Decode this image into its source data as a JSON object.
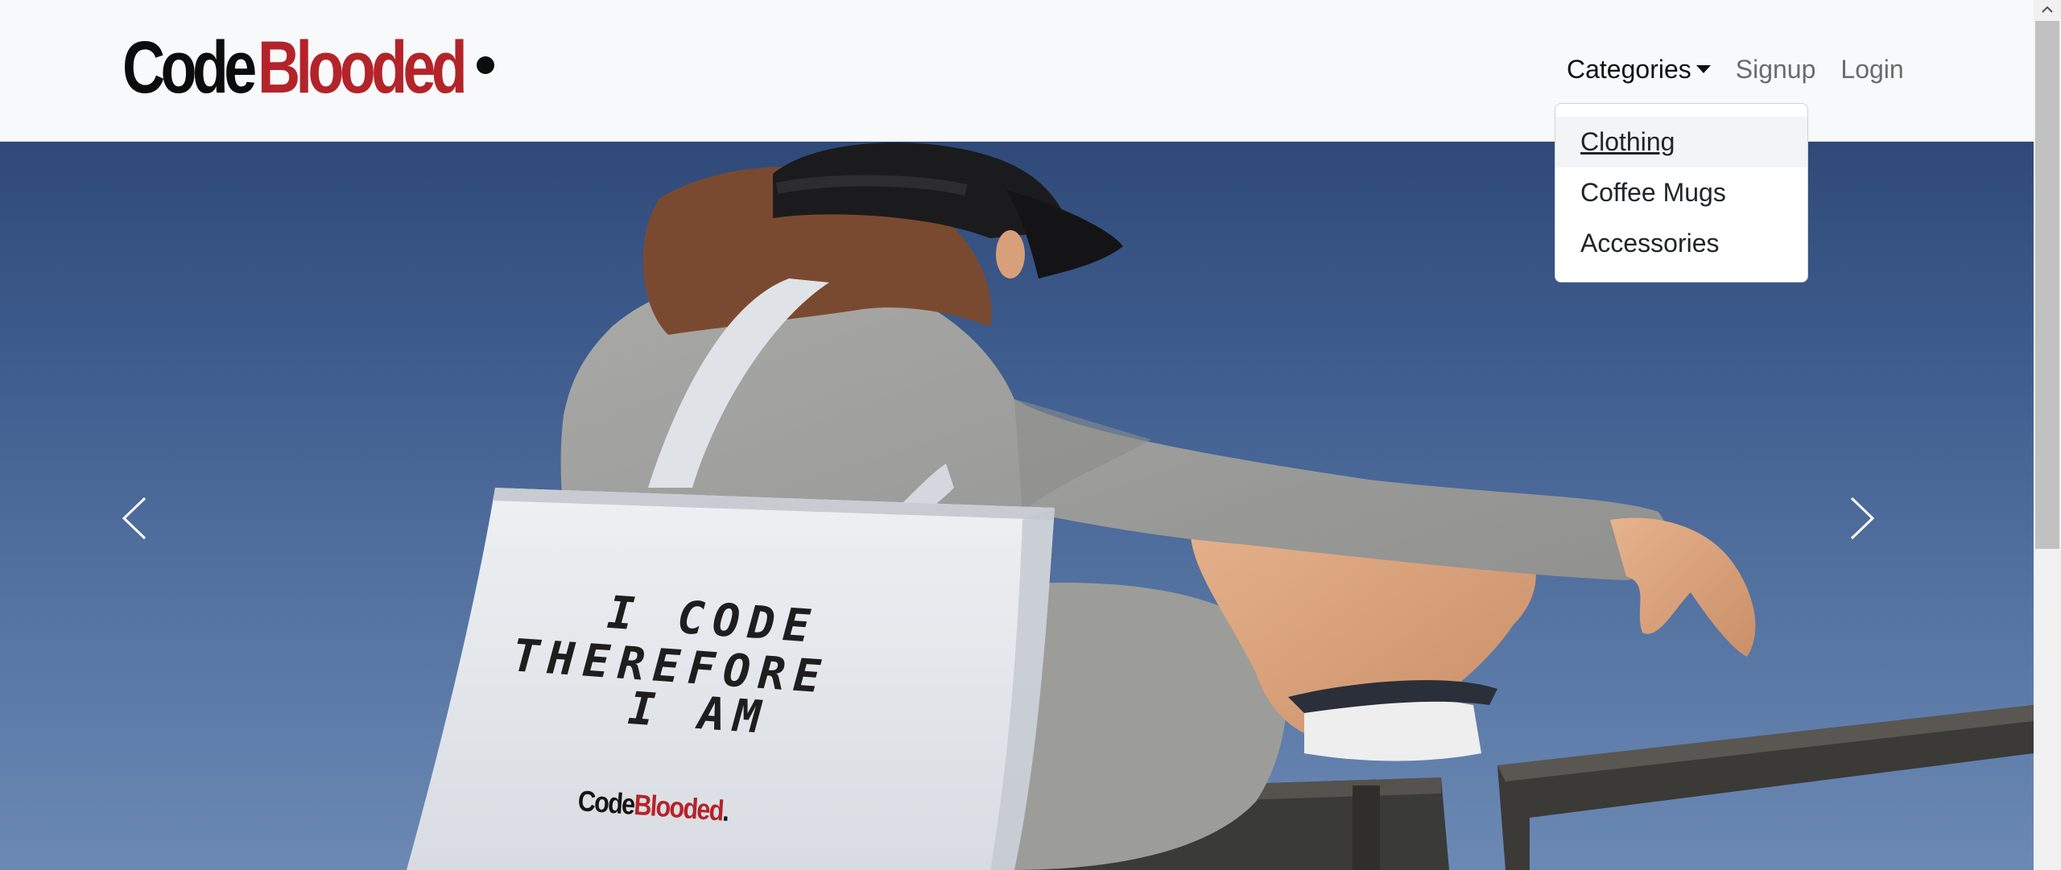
{
  "brand": {
    "name_part1": "Code",
    "name_part2": "Blooded",
    "colors": {
      "primary": "#0c0c0c",
      "accent": "#b3242a"
    }
  },
  "nav": {
    "categories_label": "Categories",
    "signup_label": "Signup",
    "login_label": "Login"
  },
  "dropdown": {
    "items": [
      {
        "label": "Clothing"
      },
      {
        "label": "Coffee Mugs"
      },
      {
        "label": "Accessories"
      }
    ]
  },
  "hero": {
    "tote_line1": "I CODE",
    "tote_line2": "THEREFORE",
    "tote_line3": "I AM",
    "tote_logo_part1": "Code",
    "tote_logo_part2": "Blooded",
    "prev_icon": "chevron-left-icon",
    "next_icon": "chevron-right-icon"
  },
  "scrollbar": {
    "up_icon": "chevron-up-icon",
    "position_fraction": 0
  }
}
